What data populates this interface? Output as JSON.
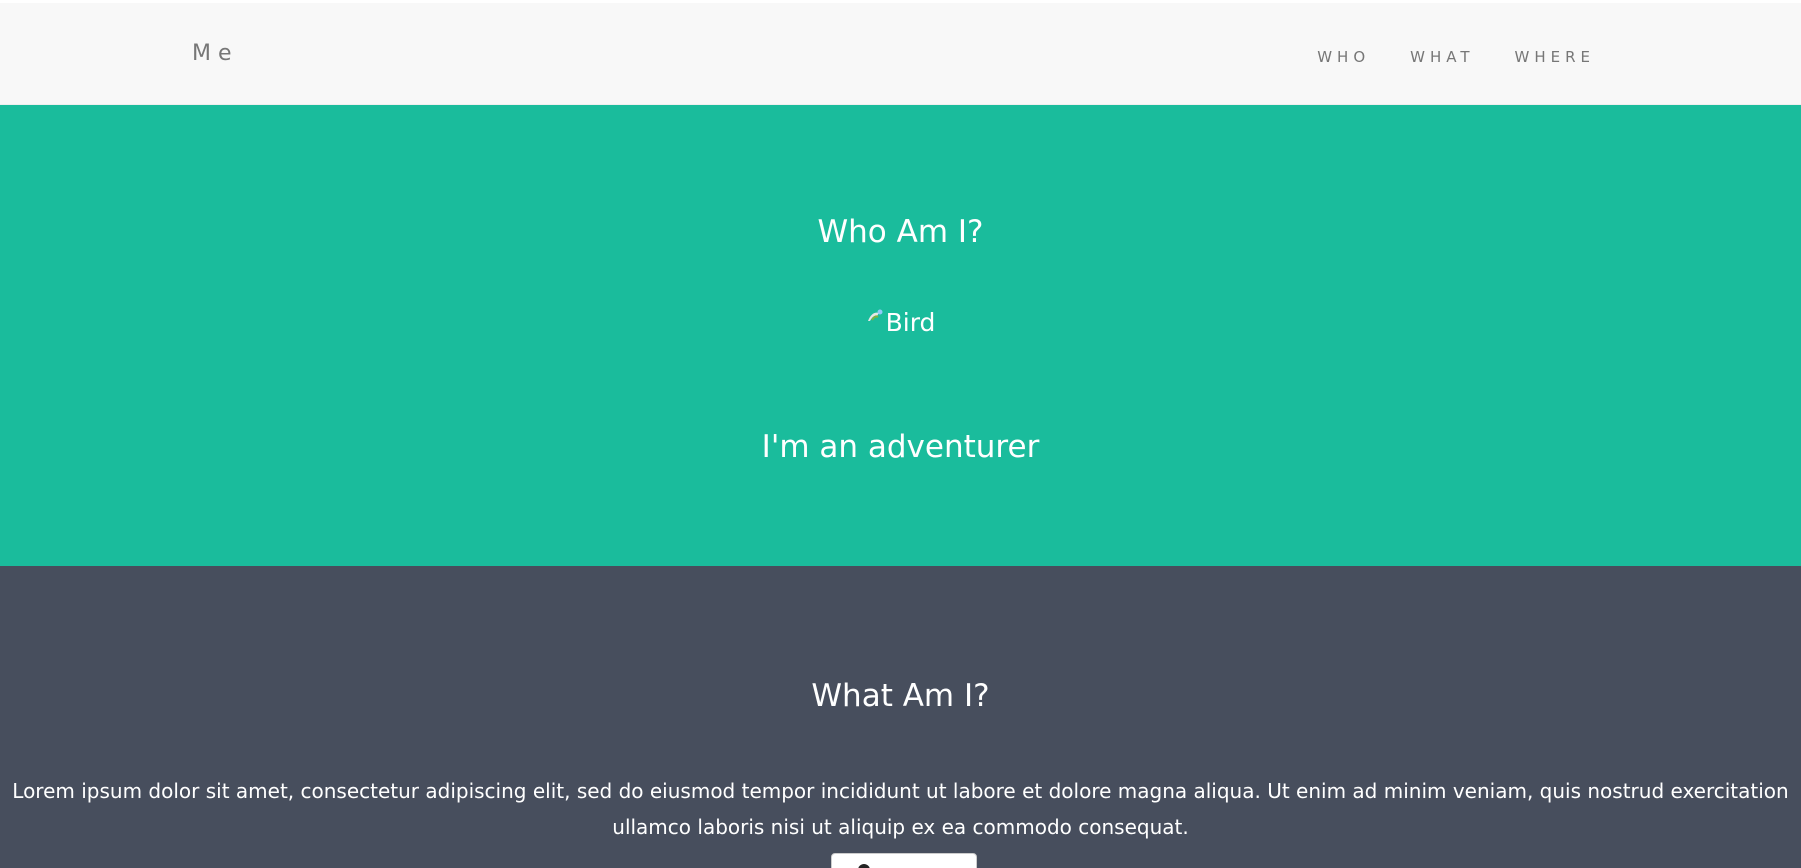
{
  "navbar": {
    "brand": "Me",
    "links": [
      {
        "label": "WHO"
      },
      {
        "label": "WHAT"
      },
      {
        "label": "WHERE"
      }
    ]
  },
  "who": {
    "title": "Who Am I?",
    "image_alt": "Bird",
    "subtitle": "I'm an adventurer"
  },
  "what": {
    "title": "What Am I?",
    "body": "Lorem ipsum dolor sit amet, consectetur adipiscing elit, sed do eiusmod tempor incididunt ut labore et dolore magna aliqua. Ut enim ad minim veniam, quis nostrud exercitation ullamco laboris nisi ut aliquip ex ea commodo consequat."
  },
  "colors": {
    "navbar_bg": "#f8f8f8",
    "who_bg": "#1abc9c",
    "what_bg": "#474e5d",
    "text_light": "#ffffff",
    "nav_text": "#777777"
  },
  "icons": {
    "broken_image": "broken-image-icon",
    "button_icon": "circle-icon"
  }
}
